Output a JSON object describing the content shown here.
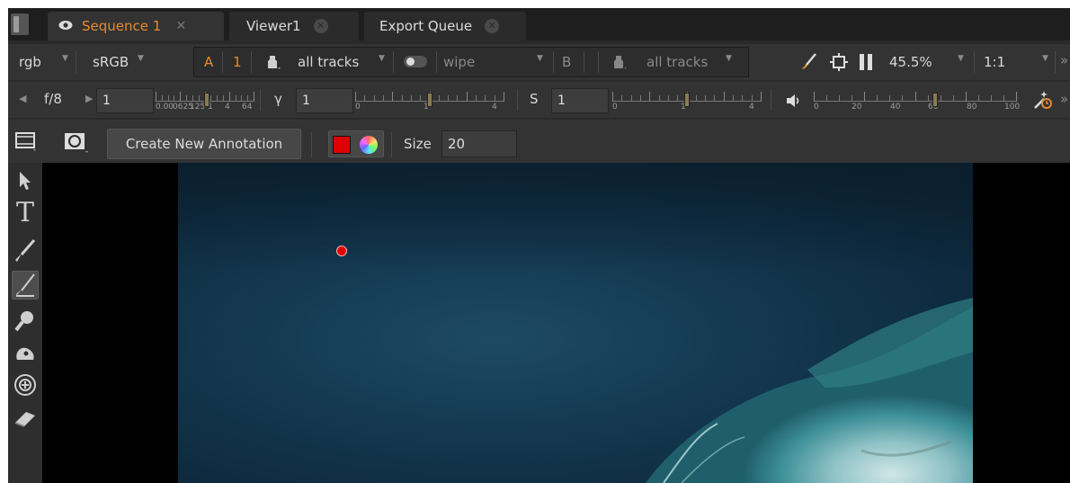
{
  "tabs": [
    {
      "label": "Sequence 1",
      "active": true
    },
    {
      "label": "Viewer1",
      "active": false
    },
    {
      "label": "Export Queue",
      "active": false
    }
  ],
  "toolbar1": {
    "channel": "rgb",
    "colorspace": "sRGB",
    "a_label": "A",
    "a_value": "1",
    "a_tracks": "all tracks",
    "wipe": "wipe",
    "b_label": "B",
    "b_tracks": "all tracks",
    "zoom": "45.5%",
    "ratio": "1:1"
  },
  "toolbar2": {
    "fstop": "f/8",
    "gain_value": "1",
    "gain_ticks": [
      "0.00",
      "0625",
      "125",
      "1",
      "4",
      "64"
    ],
    "gamma_label": "γ",
    "gamma_value": "1",
    "gamma_ticks": [
      "0",
      "1",
      "4"
    ],
    "sat_label": "S",
    "sat_value": "1",
    "sat_ticks": [
      "0",
      "1",
      "4"
    ],
    "vol_ticks": [
      "0",
      "20",
      "40",
      "60",
      "80",
      "100"
    ],
    "gain_level": 0.52,
    "gamma_level": 0.5,
    "sat_level": 0.5,
    "volume_level": 0.6
  },
  "toolbar3": {
    "create_annotation": "Create New Annotation",
    "size_label": "Size",
    "size_value": "20",
    "brush_color": "#e00000"
  },
  "colors": {
    "accent": "#e88a2e",
    "panel": "#333333",
    "viewer_bg": "#000000"
  }
}
